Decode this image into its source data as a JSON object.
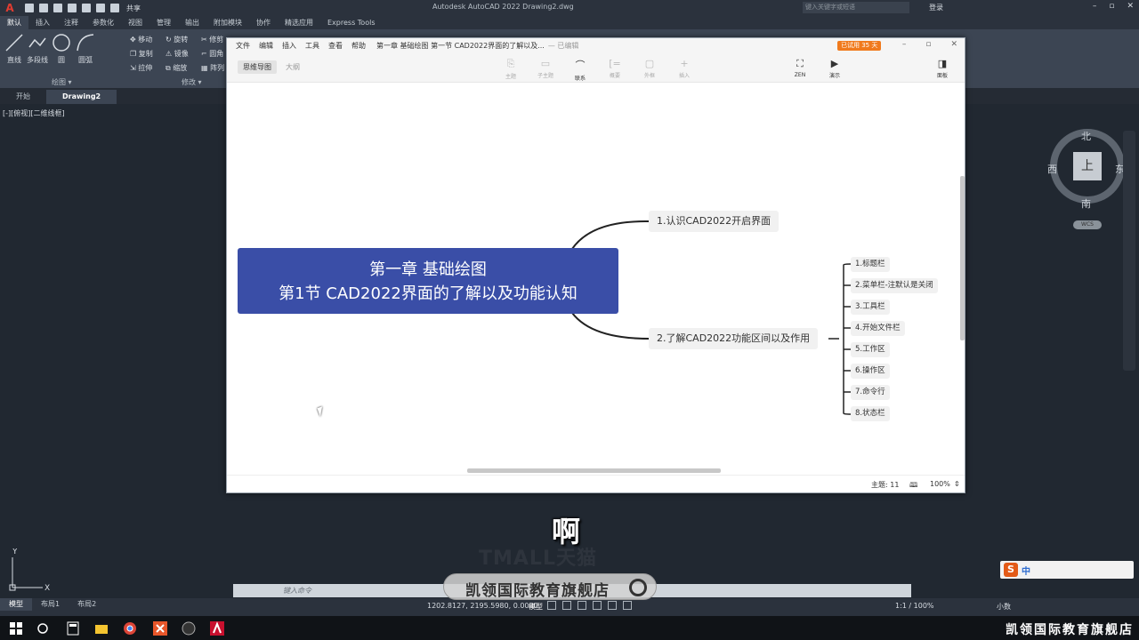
{
  "acad": {
    "title": "Autodesk AutoCAD 2022   Drawing2.dwg",
    "share_label": "共享",
    "search_placeholder": "键入关键字或短语",
    "login_label": "登录",
    "ribbon_tabs": [
      "默认",
      "插入",
      "注释",
      "参数化",
      "视图",
      "管理",
      "输出",
      "附加模块",
      "协作",
      "精选应用",
      "Express Tools"
    ],
    "draw_tools": {
      "line": "直线",
      "polyline": "多段线",
      "circle": "圆",
      "arc": "圆弧"
    },
    "modify_tools": {
      "move": "移动",
      "rotate": "旋转",
      "trim": "修剪",
      "copy": "复制",
      "mirror": "镜像",
      "fillet": "圆角",
      "stretch": "拉伸",
      "scale": "缩放",
      "array": "阵列"
    },
    "panel_labels": {
      "draw": "绘图 ▾",
      "modify": "修改 ▾"
    },
    "doc_tabs": [
      "开始",
      "Drawing2"
    ],
    "view_label": "[-][俯视][二维线框]",
    "compass": {
      "north": "北",
      "south": "南",
      "east": "东",
      "west": "西",
      "top": "上"
    },
    "wcs_label": "WCS",
    "ucs": {
      "x": "X",
      "y": "Y"
    },
    "command_placeholder": "键入命令",
    "layout_tabs": [
      "模型",
      "布局1",
      "布局2"
    ],
    "coords": "1202.8127, 2195.5980, 0.0000",
    "model_label": "模型",
    "scale_label": "1:1 / 100%",
    "units_label": "小数"
  },
  "xmind": {
    "menu": [
      "文件",
      "编辑",
      "插入",
      "工具",
      "查看",
      "帮助"
    ],
    "doc_title": "第一章 基础绘图 第一节 CAD2022界面的了解以及...",
    "doc_state": "— 已编辑",
    "trial_badge": "已试用 35 天",
    "view_tabs": [
      "思维导图",
      "大纲"
    ],
    "toolbar": [
      {
        "label": "主题",
        "enabled": false
      },
      {
        "label": "子主题",
        "enabled": false
      },
      {
        "label": "联系",
        "enabled": true
      },
      {
        "label": "概要",
        "enabled": false
      },
      {
        "label": "外框",
        "enabled": false
      },
      {
        "label": "插入",
        "enabled": false
      },
      {
        "label": "ZEN",
        "enabled": true
      },
      {
        "label": "演示",
        "enabled": true
      },
      {
        "label": "面板",
        "enabled": true
      }
    ],
    "central_topic": {
      "line1": "第一章 基础绘图",
      "line2": "第1节 CAD2022界面的了解以及功能认知"
    },
    "main_topics": [
      "1.认识CAD2022开启界面",
      "2.了解CAD2022功能区间以及作用"
    ],
    "subtopics": [
      "1.标题栏",
      "2.菜单栏-注默认是关闭",
      "3.工具栏",
      "4.开始文件栏",
      "5.工作区",
      "6.操作区",
      "7.命令行",
      "8.状态栏"
    ],
    "status": {
      "topic_count": "主题: 11",
      "zoom": "100%"
    },
    "accent_color": "#3a4ea7"
  },
  "overlay": {
    "subtitle": "啊",
    "watermark": "TMALL天猫",
    "shop_banner": "凯领国际教育旗舰店",
    "tray_text": "凯领国际教育旗舰店",
    "ime_label": "中"
  }
}
